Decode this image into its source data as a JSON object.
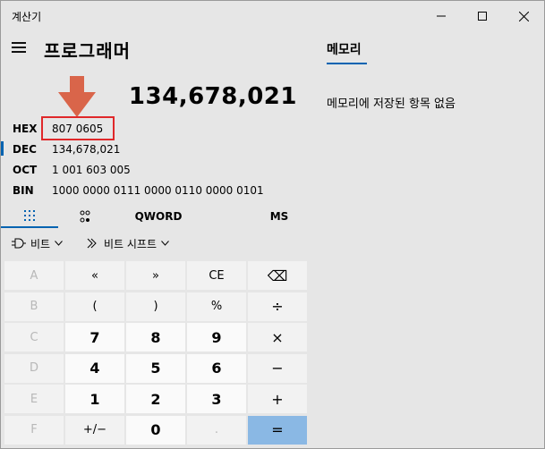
{
  "window": {
    "title": "계산기"
  },
  "header": {
    "mode_title": "프로그래머"
  },
  "display": {
    "value": "134,678,021"
  },
  "radix": [
    {
      "label": "HEX",
      "value": "807 0605"
    },
    {
      "label": "DEC",
      "value": "134,678,021"
    },
    {
      "label": "OCT",
      "value": "1 001 603 005"
    },
    {
      "label": "BIN",
      "value": "1000 0000 0111 0000 0110 0000 0101"
    }
  ],
  "tabs": {
    "word_size": "QWORD",
    "memory_store": "MS"
  },
  "operations": {
    "bitwise": "비트",
    "bit_shift": "비트 시프트"
  },
  "keys": [
    [
      "A",
      "«",
      "»",
      "CE",
      "⌫"
    ],
    [
      "B",
      "(",
      ")",
      "%",
      "÷"
    ],
    [
      "C",
      "7",
      "8",
      "9",
      "×"
    ],
    [
      "D",
      "4",
      "5",
      "6",
      "−"
    ],
    [
      "E",
      "1",
      "2",
      "3",
      "+"
    ],
    [
      "F",
      "+/−",
      "0",
      ".",
      "="
    ]
  ],
  "memory": {
    "tab_label": "메모리",
    "empty_text": "메모리에 저장된 항목 없음"
  },
  "colors": {
    "accent": "#0063b1",
    "highlight_box": "#e0282a",
    "arrow": "#d9654a",
    "equals_key": "#8ab8e4"
  }
}
